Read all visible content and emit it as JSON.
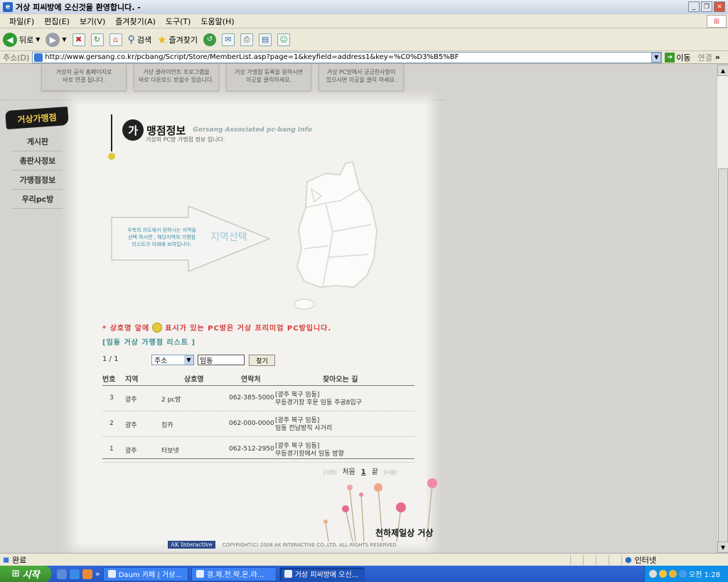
{
  "window": {
    "title": "거상 피씨방에 오신것을 환영합니다. -"
  },
  "menu": [
    "파일(F)",
    "편집(E)",
    "보기(V)",
    "즐겨찾기(A)",
    "도구(T)",
    "도움말(H)"
  ],
  "toolbar": {
    "back": "뒤로",
    "search": "검색",
    "favorites": "즐겨찾기"
  },
  "address": {
    "label": "주소(D)",
    "url": "http://www.gersang.co.kr/pcbang/Script/Store/MemberList.asp?page=1&keyfield=address1&key=%C0%D3%B5%BF",
    "go": "이동",
    "links": "연결"
  },
  "topnav": [
    "거상의 공식 홈페이지로\n바로 연결 됩니다.",
    "거상 클라이언트 프로그램을\n바로 다운로드 받을수 있습니다.",
    "거상 가맹점 등록을 원하시면\n이곳을 클릭하세요.",
    "거상 PC방에서 궁금한사항이\n있으시면 이곳을 클릭 하세요."
  ],
  "logo_text": "거상가맹점",
  "sidenav": [
    "게시판",
    "총판사정보",
    "가맹점정보",
    "우리pc방"
  ],
  "page": {
    "title_mark": "가",
    "title": "맹점정보",
    "title_en": "Gersang Associated pc-bang Info",
    "subtitle": "거상의 PC방 가맹점 정보 입니다."
  },
  "region": {
    "instruction": "우측의 지도에서 원하시는 지역을\n선택 하시면 , 해당지역의 가맹점\n리스트가 아래에 보여집니다.",
    "label": "지역선택"
  },
  "notice": {
    "before": "* 상호명 앞에",
    "after": "표시가 있는 PC방은 거상 프리미엄 PC방입니다."
  },
  "list_title": "[임동 거상 가맹점 리스트 ]",
  "pagination_top": "1 / 1",
  "search": {
    "field": "주소",
    "keyword": "임동",
    "button": "찾기"
  },
  "table": {
    "headers": [
      "번호",
      "지역",
      "상호명",
      "연락처",
      "찾아오는 길"
    ],
    "rows": [
      {
        "no": "3",
        "region": "광주",
        "name": "2 pc방",
        "phone": "062-385-5000",
        "addr1": "[광주 북구 임동]",
        "addr2": "무등경기장 후문 임동 주공8입구"
      },
      {
        "no": "2",
        "region": "광주",
        "name": "킹카",
        "phone": "062-000-0000",
        "addr1": "[광주 북구 임동]",
        "addr2": "임동 전남방직 사거리"
      },
      {
        "no": "1",
        "region": "광주",
        "name": "터보넷",
        "phone": "062-512-2950",
        "addr1": "[광주 북구 임동]",
        "addr2": "무등경기장에서 임동 방향"
      }
    ]
  },
  "pager": {
    "prev": "[이전]",
    "first": "처음",
    "current": "1",
    "last": "끝",
    "next": "[다음]"
  },
  "brand": "천하제일상 거상",
  "copyright": {
    "company_logo": "AK Interactive",
    "text": "COPYRIGHT(C) 2008 AK INTERACTIVE CO.,LTD. ALL RIGHTS RESERVED"
  },
  "status": {
    "text": "완료",
    "zone": "인터넷"
  },
  "taskbar": {
    "start": "시작",
    "tasks": [
      "Daum 카페 | 거상...",
      "경.제.전.략.온.라...",
      "거상 피씨방에 오신..."
    ],
    "clock": "오전 1:28"
  },
  "colors": {
    "notice_red": "#d93a3a",
    "list_teal": "#3b8f92",
    "accent_blue": "#9dc7d6"
  }
}
